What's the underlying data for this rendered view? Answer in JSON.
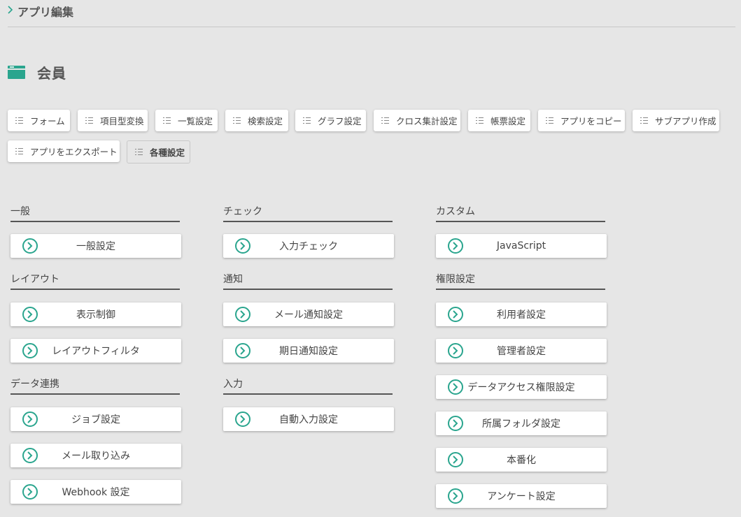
{
  "breadcrumb": {
    "label": "アプリ編集"
  },
  "app": {
    "title": "会員",
    "icon": "app-window-icon",
    "accent": "#2aa58e"
  },
  "tabs": [
    {
      "label": "フォーム"
    },
    {
      "label": "項目型変換"
    },
    {
      "label": "一覧設定"
    },
    {
      "label": "検索設定"
    },
    {
      "label": "グラフ設定"
    },
    {
      "label": "クロス集計設定"
    },
    {
      "label": "帳票設定"
    },
    {
      "label": "アプリをコピー"
    },
    {
      "label": "サブアプリ作成"
    },
    {
      "label": "アプリをエクスポート"
    },
    {
      "label": "各種設定",
      "active": true
    }
  ],
  "sections": {
    "general": {
      "title": "一般",
      "buttons": [
        "一般設定"
      ]
    },
    "layout": {
      "title": "レイアウト",
      "buttons": [
        "表示制御",
        "レイアウトフィルタ"
      ]
    },
    "data_link": {
      "title": "データ連携",
      "buttons": [
        "ジョブ設定",
        "メール取り込み",
        "Webhook 設定"
      ]
    },
    "check": {
      "title": "チェック",
      "buttons": [
        "入力チェック"
      ]
    },
    "notify": {
      "title": "通知",
      "buttons": [
        "メール通知設定",
        "期日通知設定"
      ]
    },
    "input": {
      "title": "入力",
      "buttons": [
        "自動入力設定"
      ]
    },
    "custom": {
      "title": "カスタム",
      "buttons": [
        "JavaScript"
      ]
    },
    "permissions": {
      "title": "権限設定",
      "buttons": [
        "利用者設定",
        "管理者設定",
        "データアクセス権限設定",
        "所属フォルダ設定",
        "本番化",
        "アンケート設定"
      ]
    }
  }
}
